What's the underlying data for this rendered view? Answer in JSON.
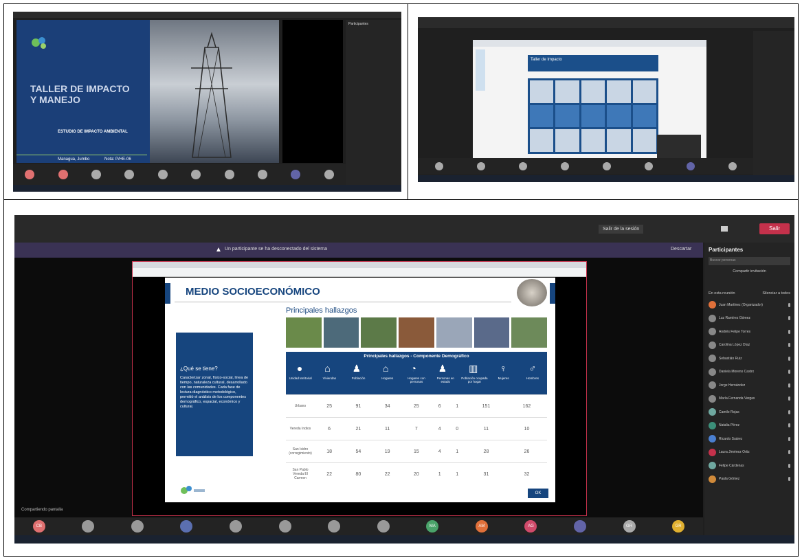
{
  "screen1": {
    "slide": {
      "title_line1": "TALLER DE IMPACTO",
      "title_line2": "Y MANEJO",
      "subtitle": "ESTUDIO DE IMPACTO AMBIENTAL",
      "footer_left": "Managua, Jumbo",
      "footer_right": "Nota: P/HE-06"
    },
    "panel_title": "Participantes"
  },
  "screen2": {
    "slide_label": "Taller de Impacto"
  },
  "screen3": {
    "banner_text": "Un participante se ha desconectado del sistema",
    "banner_button": "Descartar",
    "leave_button": "Salir",
    "share_button": "Salir de la sesión",
    "slide": {
      "title": "MEDIO SOCIOECONÓMICO",
      "findings_title": "Principales hallazgos",
      "sidebar_heading": "¿Qué se tiene?",
      "sidebar_text": "Caracterizar zonal, físico-social, línea de tiempo, naturaleza cultural, desarrollado con las comunidades. Cada fase de lectura diagnóstico metodológico, permitió el análisis de los componentes demográfico, espacial, económico y cultural.",
      "table_header": "Principales hallazgos - Componente Demográfico",
      "columns": [
        "Unidad territorial",
        "Viviendas",
        "Población",
        "Hogares",
        "Hogares con personas",
        "Personas en estado",
        "Población ocupada por hogar",
        "Mujeres",
        "Hombres"
      ],
      "rows": [
        {
          "label": "Urbano",
          "cells": [
            "25",
            "91",
            "34",
            "25",
            "6",
            "1",
            "151",
            "162"
          ]
        },
        {
          "label": "Vereda Indios",
          "cells": [
            "6",
            "21",
            "11",
            "7",
            "4",
            "0",
            "11",
            "10"
          ]
        },
        {
          "label": "San Isidro (corregimiento)",
          "cells": [
            "18",
            "54",
            "19",
            "15",
            "4",
            "1",
            "28",
            "26"
          ]
        },
        {
          "label": "San Pablo Vereda El Carmen",
          "cells": [
            "22",
            "80",
            "22",
            "20",
            "1",
            "1",
            "31",
            "32"
          ]
        }
      ],
      "next_button": "OK"
    },
    "panel_title": "Participantes",
    "panel_search": "Buscar personas",
    "panel_button": "Compartir invitación",
    "panel_section": "En esta reunión",
    "panel_action": "Silenciar a todos",
    "participants": [
      "Juan Martínez (Organizador)",
      "Luz Ramírez Gómez",
      "Andrés Felipe Torres",
      "Carolina López Díaz",
      "Sebastián Ruiz",
      "Daniela Moreno Castro",
      "Jorge Hernández",
      "María Fernanda Vargas",
      "Camilo Rojas",
      "Natalia Pérez",
      "Ricardo Suárez",
      "Laura Jiménez Ortiz",
      "Felipe Cárdenas",
      "Paula Gómez"
    ],
    "video_initials": [
      "CB",
      "",
      "",
      "",
      "",
      "",
      "",
      "",
      "MA",
      "AM",
      "AG",
      "",
      "GR",
      "GR"
    ],
    "status_label": "Compartiendo pantalla"
  },
  "colors": {
    "teams_dark": "#1f1f1f",
    "slide_blue": "#16457e",
    "leave_red": "#c4314b",
    "accent_purple": "#6264a7"
  }
}
